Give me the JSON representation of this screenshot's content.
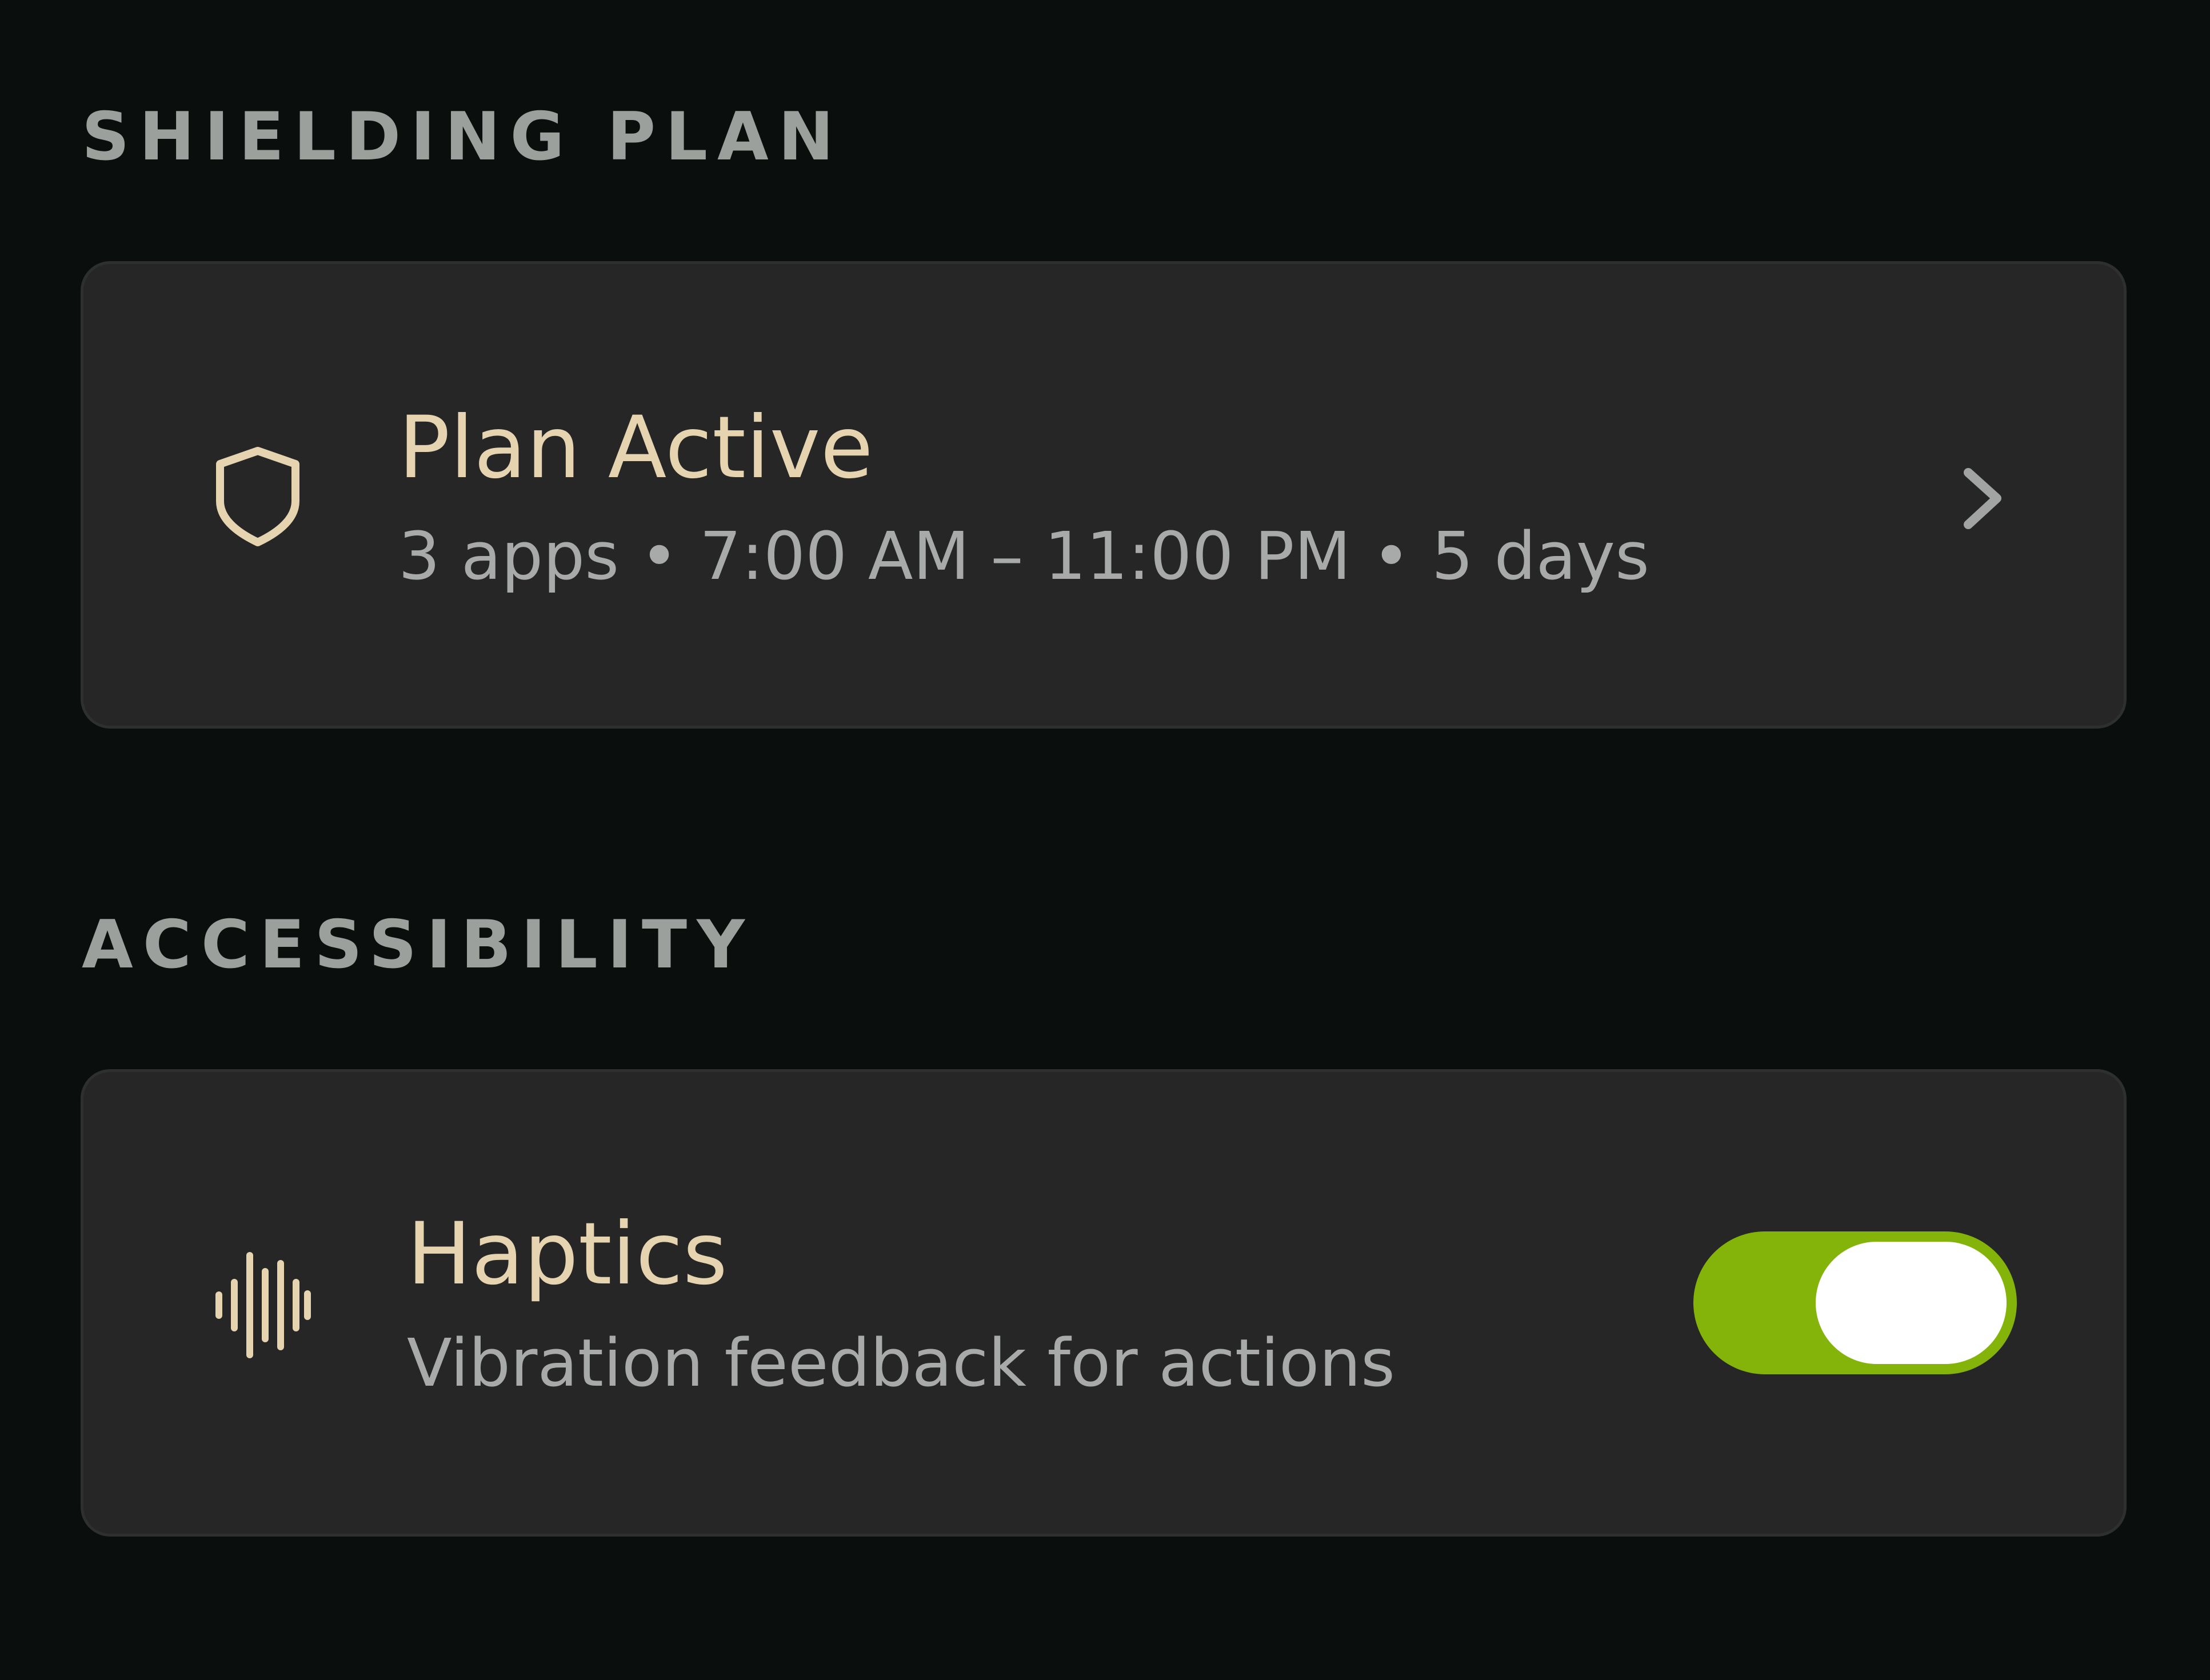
{
  "sections": {
    "shielding": {
      "header": "SHIELDING PLAN",
      "plan": {
        "icon": "shield-icon",
        "title": "Plan Active",
        "subtitle": "3 apps • 7:00 AM – 11:00 PM • 5 days",
        "trailing_icon": "chevron-right-icon"
      }
    },
    "accessibility": {
      "header": "ACCESSIBILITY",
      "haptics": {
        "icon": "waveform-icon",
        "title": "Haptics",
        "subtitle": "Vibration feedback for actions",
        "toggle_on": true
      }
    }
  },
  "colors": {
    "background": "#0a0f0e",
    "card": "#252625",
    "accent_beige": "#e6d3b0",
    "header_gray": "#9ba09d",
    "subtitle_gray": "#a8aaa9",
    "toggle_on": "#84b30a",
    "toggle_knob": "#ffffff"
  }
}
